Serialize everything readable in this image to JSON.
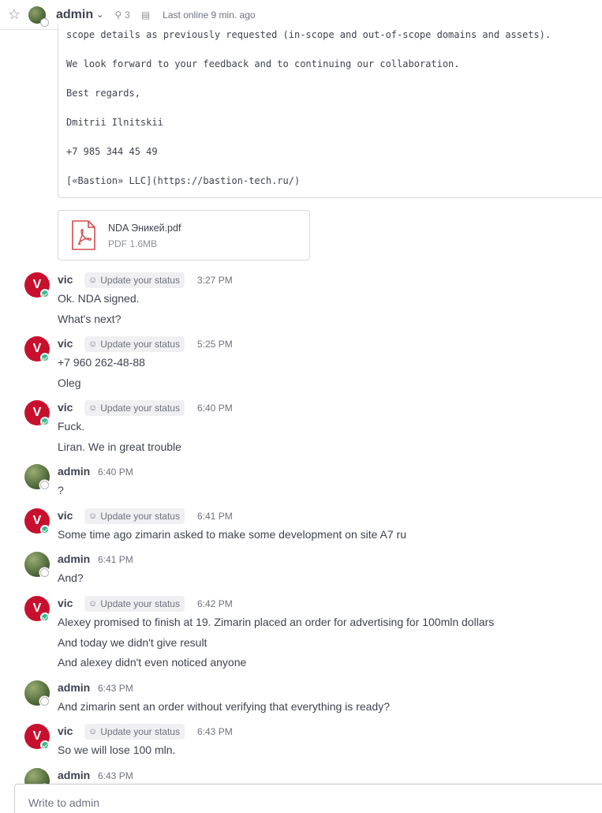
{
  "header": {
    "name": "admin",
    "pinned_count": "3",
    "last_online": "Last online 9 min. ago"
  },
  "email": {
    "lines": [
      "scope details as previously requested (in-scope and out-of-scope domains and assets).",
      "We look forward to your feedback and to continuing our collaboration.",
      "Best regards,",
      "Dmitrii Ilnitskii",
      "+7 985 344 45 49",
      "[«Bastion» LLC](https://bastion-tech.ru/)"
    ]
  },
  "attachment": {
    "name": "NDA Эникей.pdf",
    "meta": "PDF 1.6MB"
  },
  "status_badge": "Update your status",
  "avatar_initial": "V",
  "posts": [
    {
      "user": "vic",
      "time": "3:27 PM",
      "lines": [
        "Ok. NDA signed.",
        "What's next?"
      ]
    },
    {
      "user": "vic",
      "time": "5:25 PM",
      "lines": [
        "+7 960 262-48-88",
        "Oleg"
      ]
    },
    {
      "user": "vic",
      "time": "6:40 PM",
      "lines": [
        "Fuck.",
        "Liran. We in great trouble"
      ]
    },
    {
      "user": "admin",
      "time": "6:40 PM",
      "lines": [
        "?"
      ]
    },
    {
      "user": "vic",
      "time": "6:41 PM",
      "lines": [
        "Some time ago zimarin asked to make some development on site A7 ru"
      ]
    },
    {
      "user": "admin",
      "time": "6:41 PM",
      "lines": [
        "And?"
      ]
    },
    {
      "user": "vic",
      "time": "6:42 PM",
      "lines": [
        "Alexey promised to finish at 19. Zimarin placed an order for advertising for 100mln dollars",
        "And today we didn't give result",
        "And alexey didn't even noticed anyone"
      ]
    },
    {
      "user": "admin",
      "time": "6:43 PM",
      "lines": [
        "And zimarin sent an order without verifying that everything is ready?"
      ]
    },
    {
      "user": "vic",
      "time": "6:43 PM",
      "lines": [
        "So we will lose 100 mln."
      ]
    },
    {
      "user": "admin",
      "time": "6:43 PM",
      "lines": []
    }
  ],
  "composer": {
    "placeholder": "Write to admin"
  },
  "colors": {
    "vic_avatar": "#c8102e",
    "online": "#3db887",
    "pdf_red": "#d24b4e"
  }
}
